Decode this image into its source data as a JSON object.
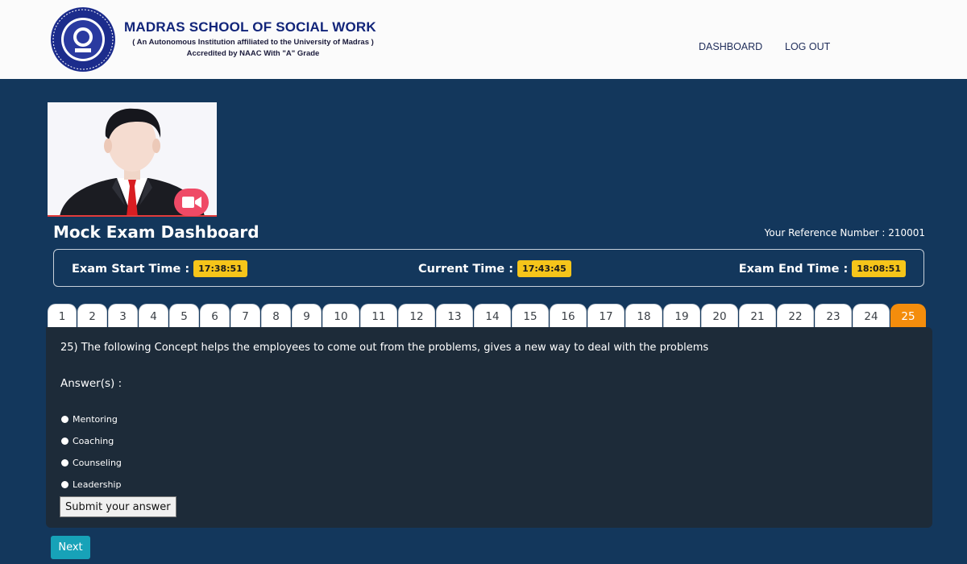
{
  "header": {
    "brand_title": "MADRAS SCHOOL OF SOCIAL WORK",
    "brand_subtitle": "( An Autonomous Institution affiliated to the University of Madras )",
    "brand_accreditation": "Accredited by NAAC With \"A\" Grade",
    "nav": [
      {
        "label": "DASHBOARD"
      },
      {
        "label": "LOG OUT"
      }
    ]
  },
  "webcam": {
    "icon": "video-camera-icon",
    "button_color": "#ef4a66"
  },
  "page": {
    "title": "Mock Exam Dashboard",
    "reference": "Your Reference Number : 210001"
  },
  "times": {
    "start_label": "Exam Start Time :",
    "start_value": "17:38:51",
    "current_label": "Current Time :",
    "current_value": "17:43:45",
    "end_label": "Exam End Time :",
    "end_value": "18:08:51"
  },
  "tabs": [
    "1",
    "2",
    "3",
    "4",
    "5",
    "6",
    "7",
    "8",
    "9",
    "10",
    "11",
    "12",
    "13",
    "14",
    "15",
    "16",
    "17",
    "18",
    "19",
    "20",
    "21",
    "22",
    "23",
    "24",
    "25"
  ],
  "active_tab": "25",
  "question": {
    "text": "25) The following Concept helps the employees to come out from the problems, gives a new way to deal with the problems",
    "answers_label": "Answer(s) :",
    "options": [
      "Mentoring",
      "Coaching",
      "Counseling",
      "Leadership"
    ],
    "submit_label": "Submit your answer"
  },
  "next_label": "Next",
  "colors": {
    "page_bg": "#13375c",
    "panel_bg": "#1d2b39",
    "active_tab": "#f48d0c",
    "time_badge": "#f6c51a",
    "next_button": "#17a2b8",
    "brand_text": "#12257a"
  }
}
